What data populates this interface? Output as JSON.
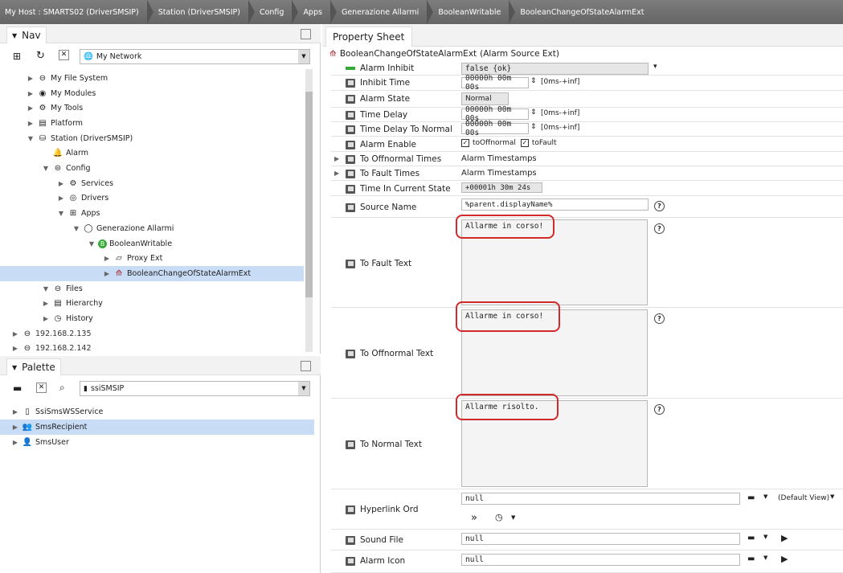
{
  "breadcrumb": [
    "My Host : SMARTS02 (DriverSMSIP)",
    "Station (DriverSMSIP)",
    "Config",
    "Apps",
    "Generazione Allarmi",
    "BooleanWritable",
    "BooleanChangeOfStateAlarmExt"
  ],
  "nav": {
    "title": "Nav",
    "network_select": "My Network",
    "tree": [
      {
        "label": "My File System",
        "icon": "drive-icon",
        "depth": 1,
        "arrow": "▶"
      },
      {
        "label": "My Modules",
        "icon": "modules-icon",
        "depth": 1,
        "arrow": "▶"
      },
      {
        "label": "My Tools",
        "icon": "tools-icon",
        "depth": 1,
        "arrow": "▶"
      },
      {
        "label": "Platform",
        "icon": "platform-icon",
        "depth": 1,
        "arrow": "▶"
      },
      {
        "label": "Station (DriverSMSIP)",
        "icon": "station-icon",
        "depth": 1,
        "arrow": "▼"
      },
      {
        "label": "Alarm",
        "icon": "bell-icon",
        "depth": 2,
        "arrow": ""
      },
      {
        "label": "Config",
        "icon": "config-icon",
        "depth": 2,
        "arrow": "▼"
      },
      {
        "label": "Services",
        "icon": "services-icon",
        "depth": 3,
        "arrow": "▶"
      },
      {
        "label": "Drivers",
        "icon": "drivers-icon",
        "depth": 3,
        "arrow": "▶"
      },
      {
        "label": "Apps",
        "icon": "apps-icon",
        "depth": 3,
        "arrow": "▼"
      },
      {
        "label": "Generazione Allarmi",
        "icon": "folder-icon",
        "depth": 4,
        "arrow": "▼"
      },
      {
        "label": "BooleanWritable",
        "icon": "boolean-icon",
        "depth": 5,
        "arrow": "▼"
      },
      {
        "label": "Proxy Ext",
        "icon": "proxy-icon",
        "depth": 6,
        "arrow": "▶"
      },
      {
        "label": "BooleanChangeOfStateAlarmExt",
        "icon": "alarm-ext-icon",
        "depth": 6,
        "arrow": "▶",
        "selected": true
      },
      {
        "label": "Files",
        "icon": "files-icon",
        "depth": 2,
        "arrow": "▼"
      },
      {
        "label": "Hierarchy",
        "icon": "hierarchy-icon",
        "depth": 2,
        "arrow": "▶"
      },
      {
        "label": "History",
        "icon": "history-icon",
        "depth": 2,
        "arrow": "▶"
      },
      {
        "label": "192.168.2.135",
        "icon": "host-icon",
        "depth": 0,
        "arrow": "▶"
      },
      {
        "label": "192.168.2.142",
        "icon": "host-icon",
        "depth": 0,
        "arrow": "▶"
      }
    ]
  },
  "palette": {
    "title": "Palette",
    "module_select": "ssiSMSIP",
    "items": [
      {
        "label": "SsiSmsWSService",
        "icon": "service-icon"
      },
      {
        "label": "SmsRecipient",
        "icon": "recipient-icon",
        "selected": true
      },
      {
        "label": "SmsUser",
        "icon": "user-icon"
      }
    ]
  },
  "property_sheet": {
    "tab": "Property Sheet",
    "component": "BooleanChangeOfStateAlarmExt",
    "component_type": "(Alarm Source Ext)",
    "alarm_inhibit": {
      "label": "Alarm Inhibit",
      "value": "false {ok}"
    },
    "inhibit_time": {
      "label": "Inhibit Time",
      "value": "00000h 00m 00s",
      "range": "[0ms-+inf]"
    },
    "alarm_state": {
      "label": "Alarm State",
      "value": "Normal"
    },
    "time_delay": {
      "label": "Time Delay",
      "value": "00000h 00m 00s",
      "range": "[0ms-+inf]"
    },
    "time_delay_normal": {
      "label": "Time Delay To Normal",
      "value": "00000h 00m 00s",
      "range": "[0ms-+inf]"
    },
    "alarm_enable": {
      "label": "Alarm Enable",
      "opt1": "toOffnormal",
      "opt2": "toFault"
    },
    "to_offnormal_times": {
      "label": "To Offnormal Times",
      "value": "Alarm Timestamps"
    },
    "to_fault_times": {
      "label": "To Fault Times",
      "value": "Alarm Timestamps"
    },
    "time_in_state": {
      "label": "Time In Current State",
      "value": "+00001h 30m 24s"
    },
    "source_name": {
      "label": "Source Name",
      "value": "%parent.displayName%"
    },
    "to_fault_text": {
      "label": "To Fault Text",
      "value": "Allarme in corso!"
    },
    "to_offnormal_text": {
      "label": "To Offnormal Text",
      "value": "Allarme in corso!"
    },
    "to_normal_text": {
      "label": "To Normal Text",
      "value": "Allarme risolto."
    },
    "hyperlink_ord": {
      "label": "Hyperlink Ord",
      "value": "null",
      "view": "(Default View)"
    },
    "sound_file": {
      "label": "Sound File",
      "value": "null"
    },
    "alarm_icon": {
      "label": "Alarm Icon",
      "value": "null"
    }
  },
  "colors": {
    "accent_red": "#d12a2a",
    "selection": "#c8dcf5",
    "header": "#6e6e6e"
  }
}
